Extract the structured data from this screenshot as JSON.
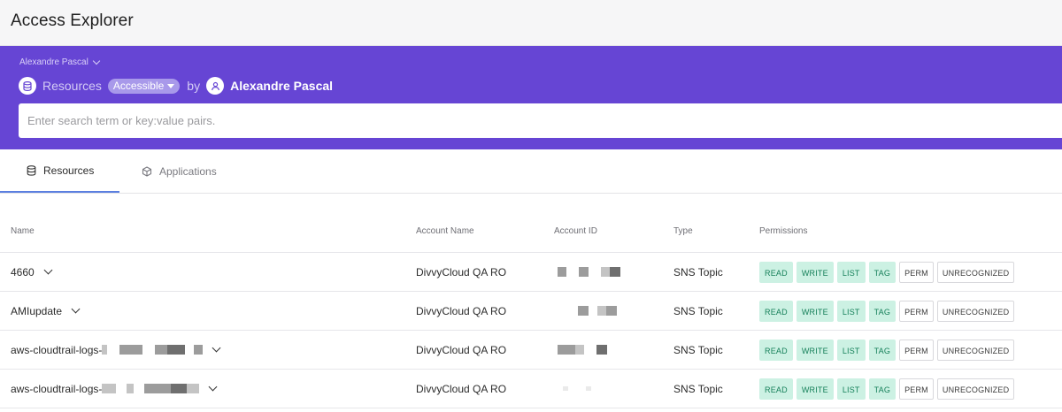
{
  "app": {
    "title": "Access Explorer"
  },
  "header": {
    "user_switch": "Alexandre Pascal",
    "query": {
      "subject": "Resources",
      "filter": "Accessible",
      "connector": "by",
      "user": "Alexandre Pascal"
    },
    "search": {
      "placeholder": "Enter search term or key:value pairs.",
      "value": ""
    }
  },
  "tabs": [
    {
      "label": "Resources",
      "active": true,
      "icon": "database-icon"
    },
    {
      "label": "Applications",
      "active": false,
      "icon": "cube-icon"
    }
  ],
  "table": {
    "columns": [
      "Name",
      "Account Name",
      "Account ID",
      "Type",
      "Permissions"
    ],
    "rows": [
      {
        "name": "4660",
        "account_name": "DivvyCloud QA RO",
        "type": "SNS Topic",
        "permissions": [
          "READ",
          "WRITE",
          "LIST",
          "TAG",
          "PERM",
          "UNRECOGNIZED"
        ]
      },
      {
        "name": "AMIupdate",
        "account_name": "DivvyCloud QA RO",
        "type": "SNS Topic",
        "permissions": [
          "READ",
          "WRITE",
          "LIST",
          "TAG",
          "PERM",
          "UNRECOGNIZED"
        ]
      },
      {
        "name": "aws-cloudtrail-logs-",
        "account_name": "DivvyCloud QA RO",
        "type": "SNS Topic",
        "permissions": [
          "READ",
          "WRITE",
          "LIST",
          "TAG",
          "PERM",
          "UNRECOGNIZED"
        ]
      },
      {
        "name": "aws-cloudtrail-logs-",
        "account_name": "DivvyCloud QA RO",
        "type": "SNS Topic",
        "permissions": [
          "READ",
          "WRITE",
          "LIST",
          "TAG",
          "PERM",
          "UNRECOGNIZED"
        ]
      }
    ]
  },
  "colors": {
    "header_purple": "#6645d4",
    "badge_green_bg": "#ccf1e3",
    "badge_green_text": "#16805a",
    "tab_underline": "#5b7fe0"
  }
}
